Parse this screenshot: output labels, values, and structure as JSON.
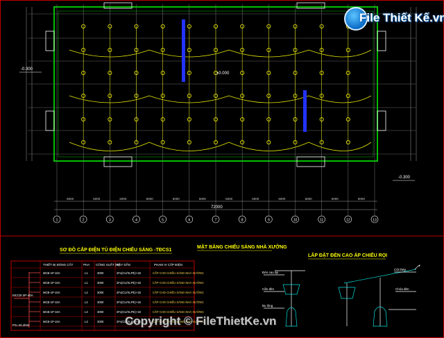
{
  "watermark": {
    "brand_name": "File Thiết Kế.vn",
    "copyright": "Copyright © FileThietKe.vn"
  },
  "plan": {
    "level_left": "-0.300",
    "level_mid": "±0.000",
    "level_right": "-0.300",
    "overall_dim": "72000",
    "bay_dim": "6000",
    "col_labels": [
      "1",
      "2",
      "3",
      "4",
      "5",
      "6",
      "7",
      "8",
      "9",
      "10",
      "11",
      "12",
      "13"
    ]
  },
  "titles": {
    "single_line": "SƠ ĐỒ CẤP ĐIỆN TỦ ĐIỆN CHIẾU SÁNG -TĐCS1",
    "layout": "MẶT BẰNG CHIẾU SÁNG NHÀ XƯỞNG",
    "detail": "LẮP ĐẶT ĐÈN CAO ÁP CHIẾU RỌI"
  },
  "table": {
    "headers": [
      "THIẾT BỊ ĐÓNG CẮT",
      "PHA",
      "CÔNG SUẤT (W)",
      "DÂY DẪN",
      "PHẠM VI CẤP ĐIỆN"
    ],
    "rows": [
      [
        "MCB-1P-10A",
        "L1",
        "3000",
        "2Fx(CU/XLPE)+1E",
        "CẤP CHO CHIẾU SÁNG NHÀ XƯỞNG"
      ],
      [
        "MCB-1P-10A",
        "L1",
        "3000",
        "2Fx(CU/XLPE)+1E",
        "CẤP CHO CHIẾU SÁNG NHÀ XƯỞNG"
      ],
      [
        "MCB-1P-10A",
        "L2",
        "3000",
        "2Fx(CU/XLPE)+1E",
        "CẤP CHO CHIẾU SÁNG NHÀ XƯỞNG"
      ],
      [
        "MCB-1P-10A",
        "L2",
        "3000",
        "2Fx(CU/XLPE)+1E",
        "CẤP CHO CHIẾU SÁNG NHÀ XƯỞNG"
      ],
      [
        "MCB-1P-10A",
        "L3",
        "3000",
        "2Fx(CU/XLPE)+1E",
        "CẤP CHO CHIẾU SÁNG NHÀ XƯỞNG"
      ],
      [
        "MCB-1P-10A",
        "L3",
        "3000",
        "2Fx(CU/XLPE)+1E",
        "CẤP CHO CHIẾU SÁNG NHÀ XƯỞNG"
      ]
    ],
    "main_breaker": "MCCB-3P-40A",
    "supply": "PS=26,4kW"
  },
  "detail": {
    "labels": [
      "Đèn cao áp",
      "Cần đèn",
      "Bu lông",
      "Cột thép",
      "Chóa đèn"
    ]
  }
}
